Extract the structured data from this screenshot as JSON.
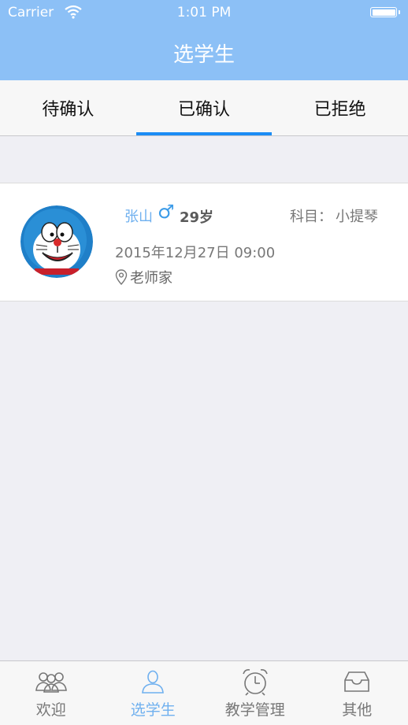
{
  "status_bar": {
    "carrier": "Carrier",
    "time": "1:01 PM"
  },
  "nav": {
    "title": "选学生"
  },
  "tabs": [
    {
      "label": "待确认"
    },
    {
      "label": "已确认",
      "active": true
    },
    {
      "label": "已拒绝"
    }
  ],
  "student": {
    "name": "张山",
    "gender_symbol": "♂",
    "age": "29岁",
    "subject_label": "科目：",
    "subject": "小提琴",
    "datetime": "2015年12月27日 09:00",
    "location": "老师家"
  },
  "tab_bar": [
    {
      "label": "欢迎",
      "icon": "people-icon"
    },
    {
      "label": "选学生",
      "icon": "person-icon",
      "active": true
    },
    {
      "label": "教学管理",
      "icon": "alarm-clock-icon"
    },
    {
      "label": "其他",
      "icon": "inbox-icon"
    }
  ],
  "colors": {
    "nav_bg": "#8cc0f6",
    "accent": "#1c8cf5",
    "active_tab_item": "#6fb0ef",
    "page_bg": "#efeff4"
  }
}
